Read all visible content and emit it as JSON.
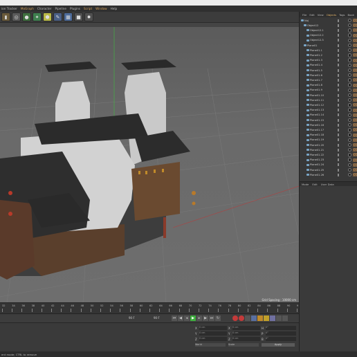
{
  "menubar": {
    "items": [
      "ion Tracker",
      "MoGraph",
      "Character",
      "Pipeline",
      "Plugins",
      "Script",
      "Window",
      "Help"
    ],
    "highlighted": [
      "MoGraph",
      "Script",
      "Window"
    ]
  },
  "toolbar": {
    "icons": [
      "film-icon",
      "render-icon",
      "sphere-icon",
      "primitive-icon",
      "deformer-icon",
      "scene-icon",
      "camera-icon",
      "light-icon"
    ]
  },
  "object_manager": {
    "tabs": [
      "File",
      "Edit",
      "View",
      "Objects",
      "Tags",
      "Book"
    ],
    "active_tab": "Objects",
    "rows": [
      {
        "label": "Nuj",
        "depth": 0
      },
      {
        "label": "Object12",
        "depth": 1
      },
      {
        "label": "Object12.1",
        "depth": 2
      },
      {
        "label": "Object12.2",
        "depth": 2
      },
      {
        "label": "Object12.3",
        "depth": 2
      },
      {
        "label": "Plane01",
        "depth": 1
      },
      {
        "label": "Plane01.1",
        "depth": 2
      },
      {
        "label": "Plane01.2",
        "depth": 2
      },
      {
        "label": "Plane01.3",
        "depth": 2
      },
      {
        "label": "Plane01.4",
        "depth": 2
      },
      {
        "label": "Plane01.5",
        "depth": 2
      },
      {
        "label": "Plane01.6",
        "depth": 2
      },
      {
        "label": "Plane01.7",
        "depth": 2
      },
      {
        "label": "Plane01.8",
        "depth": 2
      },
      {
        "label": "Plane01.9",
        "depth": 2
      },
      {
        "label": "Plane01.10",
        "depth": 2
      },
      {
        "label": "Plane01.11",
        "depth": 2
      },
      {
        "label": "Plane01.12",
        "depth": 2
      },
      {
        "label": "Plane01.13",
        "depth": 2
      },
      {
        "label": "Plane01.14",
        "depth": 2
      },
      {
        "label": "Plane01.15",
        "depth": 2
      },
      {
        "label": "Plane01.16",
        "depth": 2
      },
      {
        "label": "Plane01.17",
        "depth": 2
      },
      {
        "label": "Plane01.18",
        "depth": 2
      },
      {
        "label": "Plane01.19",
        "depth": 2
      },
      {
        "label": "Plane01.20",
        "depth": 2
      },
      {
        "label": "Plane01.21",
        "depth": 2
      },
      {
        "label": "Plane01.22",
        "depth": 2
      },
      {
        "label": "Plane01.23",
        "depth": 2
      },
      {
        "label": "Plane01.24",
        "depth": 2
      },
      {
        "label": "Plane01.25",
        "depth": 2
      },
      {
        "label": "Plane01.26",
        "depth": 2
      }
    ]
  },
  "attribute_manager": {
    "tabs": [
      "Mode",
      "Edit",
      "User Data"
    ]
  },
  "viewport": {
    "grid_spacing": "Grid Spacing : 10000 cm"
  },
  "timeline": {
    "ticks": [
      "32",
      "34",
      "36",
      "38",
      "40",
      "42",
      "44",
      "46",
      "48",
      "50",
      "52",
      "54",
      "56",
      "58",
      "60",
      "62",
      "64",
      "66",
      "68",
      "70",
      "72",
      "74",
      "76",
      "78",
      "80",
      "82",
      "84",
      "86",
      "88",
      "90",
      "9"
    ],
    "current_frame": "90 F",
    "end_frame": "90 F"
  },
  "coordinates": {
    "rows": [
      {
        "axis": "X",
        "val": "0 cm",
        "axis2": "X",
        "val2": "0 cm",
        "axis3": "H",
        "val3": "0°"
      },
      {
        "axis": "Y",
        "val": "0 cm",
        "axis2": "Y",
        "val2": "0 cm",
        "axis3": "P",
        "val3": "0°"
      },
      {
        "axis": "Z",
        "val": "0 cm",
        "axis2": "Z",
        "val2": "0 cm",
        "axis3": "B",
        "val3": "0°"
      }
    ],
    "mode_select": "World",
    "scale_select": "Scale",
    "apply_label": "Apply"
  },
  "status": {
    "text": "ent mode; CTRL to remove"
  },
  "colors": {
    "accent": "#d6a25a",
    "viewport_bg": "#666666",
    "play_green": "#3fae3f",
    "record_red": "#c43a3a"
  }
}
